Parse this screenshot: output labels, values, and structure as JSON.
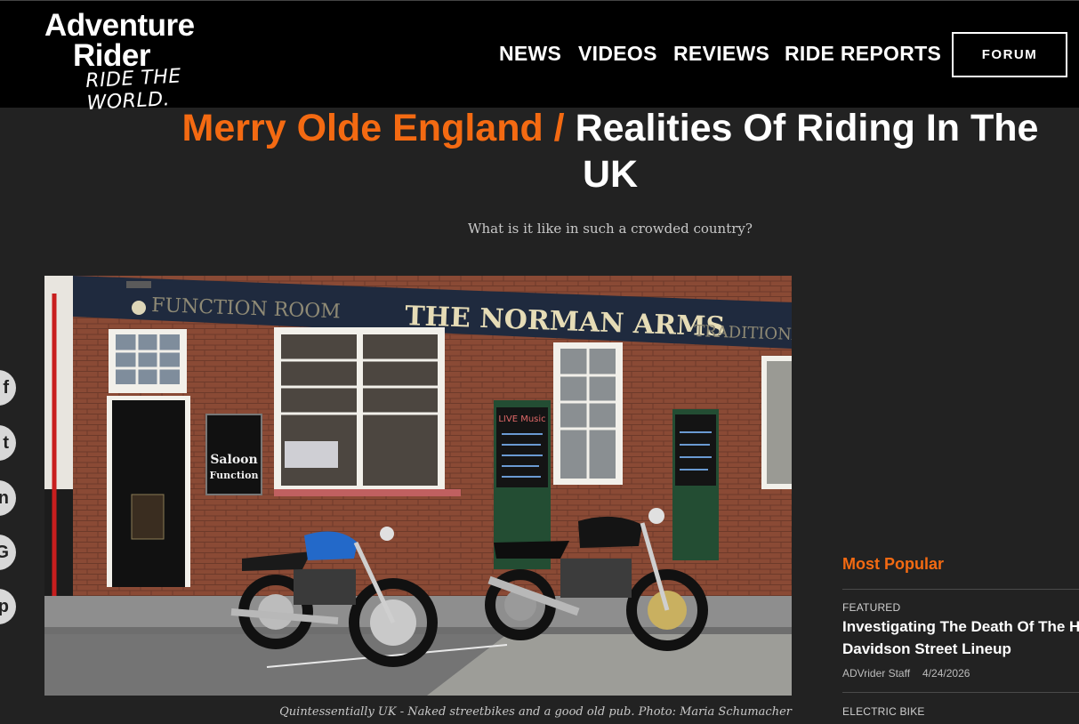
{
  "header": {
    "logo": {
      "line1": "Adventure",
      "line2": "Rider",
      "tagline": "RIDE THE WORLD."
    },
    "nav": [
      "NEWS",
      "VIDEOS",
      "REVIEWS",
      "RIDE REPORTS"
    ],
    "forum_label": "FORUM"
  },
  "article": {
    "category": "Merry Olde England /",
    "title": "Realities Of Riding In The UK",
    "subtitle": "What is it like in such a crowded country?",
    "photo_signs": {
      "function_room": "FUNCTION ROOM",
      "pub_name": "THE NORMAN ARMS",
      "traditional": "TRADITIONAL",
      "saloon": "Saloon",
      "function": "Function",
      "live_music": "LIVE Music"
    },
    "caption": "Quintessentially UK - Naked streetbikes and a good old pub. Photo: Maria Schumacher"
  },
  "social": [
    {
      "icon": "facebook-icon",
      "glyph": "f"
    },
    {
      "icon": "twitter-icon",
      "glyph": "t"
    },
    {
      "icon": "linkedin-icon",
      "glyph": "in"
    },
    {
      "icon": "google-plus-icon",
      "glyph": "G"
    },
    {
      "icon": "pinterest-icon",
      "glyph": "p"
    }
  ],
  "sidebar": {
    "heading": "Most Popular",
    "items": [
      {
        "tag": "FEATURED",
        "title": "Investigating The Death Of The Harley-Davidson Street Lineup",
        "title_line1": "Investigating The Death Of The Harley-",
        "title_line2": "Davidson Street Lineup",
        "author": "ADVrider Staff",
        "date": "4/24/2026"
      },
      {
        "tag": "ELECTRIC BIKE"
      }
    ]
  },
  "colors": {
    "accent": "#f46a12",
    "background": "#222222",
    "header": "#000000"
  }
}
